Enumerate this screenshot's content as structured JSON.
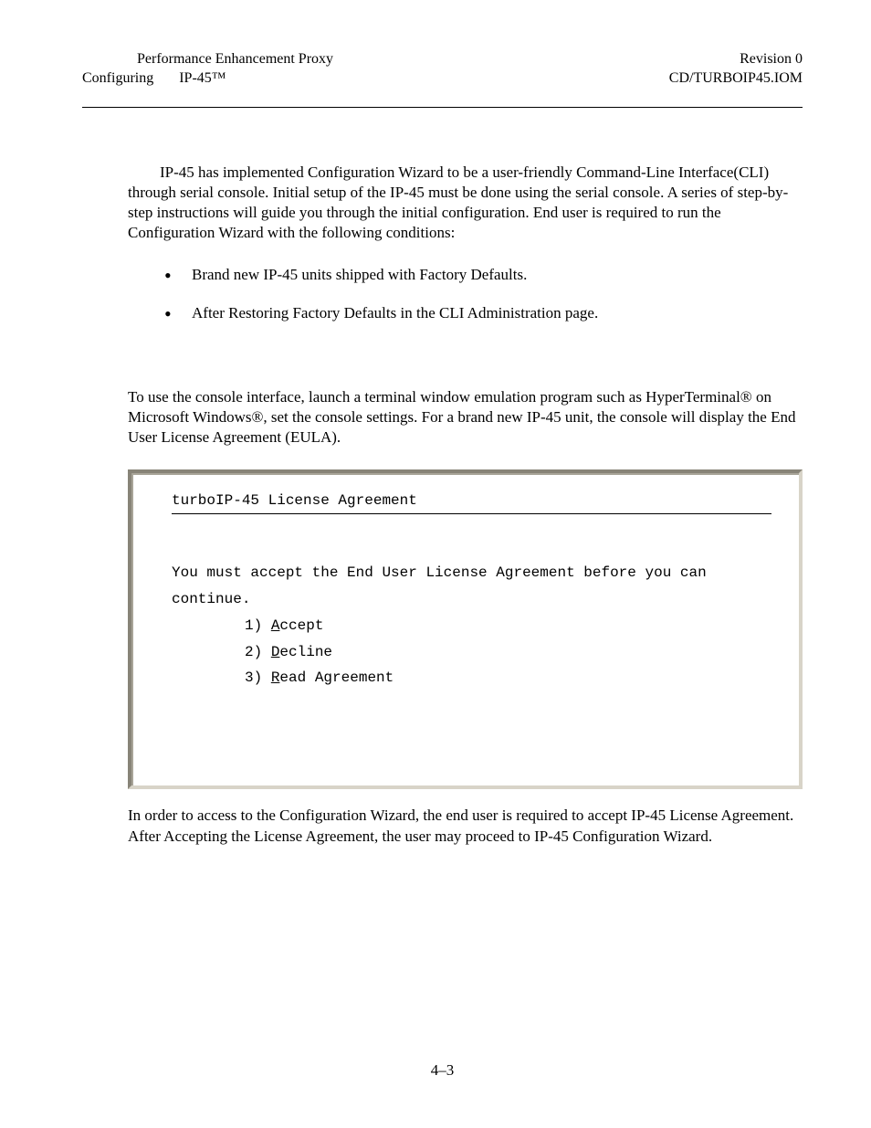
{
  "header": {
    "left_line1": "Performance Enhancement Proxy",
    "left_line2a": "Configuring",
    "left_line2b": "IP-45™",
    "right_line1": "Revision 0",
    "right_line2": "CD/TURBOIP45.IOM"
  },
  "body": {
    "para1": "IP-45 has implemented Configuration Wizard to be a user-friendly Command-Line Interface(CLI) through serial console. Initial setup of the        IP-45 must be done using the serial console. A series of step-by-step instructions will guide you through the initial configuration. End user is required to run the Configuration Wizard with the following conditions:",
    "bullets": [
      "Brand new        IP-45 units shipped with Factory Defaults.",
      "After Restoring Factory Defaults in the CLI  Administration page."
    ],
    "para2": "To use the console interface, launch a terminal window emulation program such as HyperTerminal® on Microsoft Windows®, set the console settings. For a brand new        IP-45 unit,  the console will display the End User License Agreement (EULA).",
    "para3": "In order to access to the Configuration Wizard, the end user is required to accept        IP-45 License Agreement. After Accepting the License Agreement, the user may proceed to        IP-45 Configuration Wizard."
  },
  "console": {
    "title": "turboIP-45 License Agreement",
    "prompt": "You must accept the End User License Agreement before you can continue.",
    "option1_num": "1) ",
    "option1_ul": "A",
    "option1_rest": "ccept",
    "option2_num": "2) ",
    "option2_ul": "D",
    "option2_rest": "ecline",
    "option3_num": "3) ",
    "option3_ul": "R",
    "option3_rest": "ead Agreement"
  },
  "page_number": "4–3"
}
